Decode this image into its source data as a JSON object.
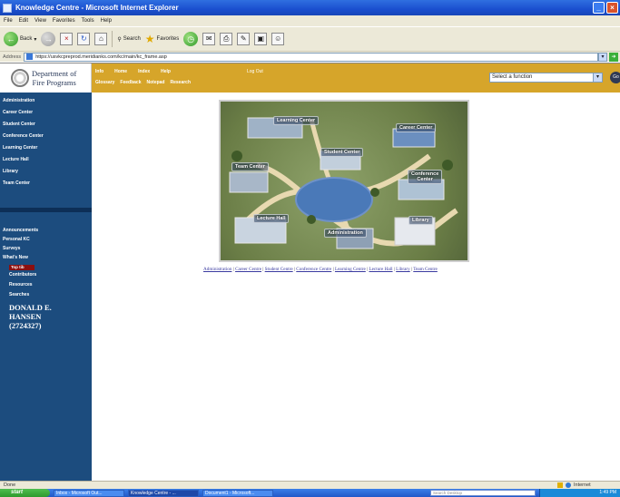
{
  "window": {
    "title": "Knowledge Centre - Microsoft Internet Explorer",
    "controls": [
      "_",
      "□",
      "×"
    ]
  },
  "menu": [
    "File",
    "Edit",
    "View",
    "Favorites",
    "Tools",
    "Help"
  ],
  "toolbar": {
    "back": "Back",
    "search": "Search",
    "favorites": "Favorites"
  },
  "address": {
    "label": "Address",
    "url": "https://usvkcpreprod.meridianks.com/kc/main/kc_frame.asp",
    "go": "Go"
  },
  "header": {
    "dept_line1": "Department of",
    "dept_line2": "Fire Programs",
    "nav1": [
      "Info",
      "Home",
      "Index",
      "Help"
    ],
    "logout": "Log Out",
    "nav2": [
      "Glossary",
      "Feedback",
      "Notepad",
      "Research"
    ],
    "select_function": "Select a function",
    "go": "Go"
  },
  "sidebar": {
    "centers": [
      "Administration",
      "Career Center",
      "Student Center",
      "Conference Center",
      "Learning Center",
      "Lecture Hall",
      "Library",
      "Team Center"
    ],
    "tools": [
      "Announcements",
      "Personal KC",
      "Surveys",
      "What's New"
    ],
    "top_strip": "Top tib",
    "sub": [
      "Contributors",
      "Resources",
      "Searches"
    ],
    "user_line1": "DONALD E.",
    "user_line2": "HANSEN",
    "user_line3": "(2724327)"
  },
  "map": {
    "labels": {
      "learning": "Learning Center",
      "career": "Career Center",
      "student": "Student Center",
      "team": "Team Center",
      "conference_1": "Conference",
      "conference_2": "Center",
      "lecture": "Lecture Hall",
      "library": "Library",
      "administration": "Administration"
    }
  },
  "links": [
    "Administration",
    "Career Centre",
    "Student Centre",
    "Conference Centre",
    "Learning Centre",
    "Lecture Hall",
    "Library",
    "Team Centre"
  ],
  "status": {
    "left": "Done",
    "zone": "Internet"
  },
  "taskbar": {
    "start": "start",
    "tasks": [
      "Inbox - Microsoft Out...",
      "Knowledge Centre - ...",
      "Document1 - Microsoft..."
    ],
    "search_placeholder": "Search Desktop",
    "clock": "1:49 PM"
  },
  "colors": {
    "header_gold": "#d6a52a",
    "sidebar_blue": "#1c4c7e",
    "link_blue": "#3a3aa0"
  }
}
